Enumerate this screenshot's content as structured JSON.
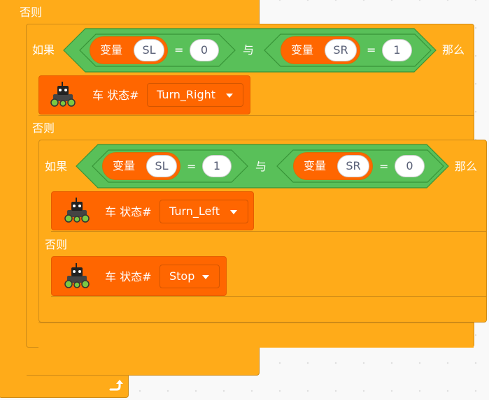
{
  "colors": {
    "control": "#ffab19",
    "operator": "#59c059",
    "data": "#ff6600",
    "extension": "#ff6600"
  },
  "outer_else_label": "否则",
  "if_label": "如果",
  "then_label": "那么",
  "else_label": "否则",
  "variable_label": "变量",
  "and_label": "与",
  "equals_label": "=",
  "car_status_label": "车 状态#",
  "condition1": {
    "left_var": "SL",
    "left_value": "0",
    "right_var": "SR",
    "right_value": "1"
  },
  "action1": {
    "dropdown_value": "Turn_Right"
  },
  "condition2": {
    "left_var": "SL",
    "left_value": "1",
    "right_var": "SR",
    "right_value": "0"
  },
  "action2": {
    "dropdown_value": "Turn_Left"
  },
  "action3": {
    "dropdown_value": "Stop"
  },
  "loop_icon": "loop-arrow-icon",
  "car_icon": "robot-car-icon"
}
